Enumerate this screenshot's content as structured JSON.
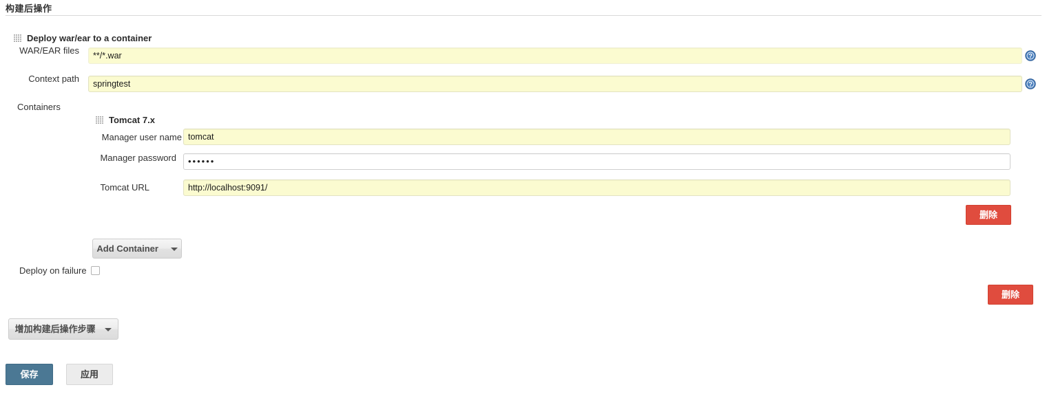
{
  "section": {
    "title": "构建后操作"
  },
  "publisher": {
    "title": "Deploy war/ear to a container",
    "grip_icon": "drag-grip-icon",
    "rows": {
      "war_label": "WAR/EAR files",
      "war_value": "**/*.war",
      "context_label": "Context path",
      "context_value": "springtest",
      "containers_label": "Containers"
    },
    "help_icon": "help-icon",
    "deploy_on_failure_label": "Deploy on failure",
    "deploy_on_failure_checked": false,
    "add_container_label": "Add Container",
    "delete_label": "删除"
  },
  "container": {
    "title": "Tomcat 7.x",
    "grip_icon": "drag-grip-icon",
    "fields": [
      {
        "label": "Manager user name",
        "value": "tomcat",
        "style": "yellow"
      },
      {
        "label": "Manager password",
        "value": "••••••",
        "style": "white"
      },
      {
        "label": "Tomcat URL",
        "value": "http://localhost:9091/",
        "style": "yellow"
      }
    ],
    "delete_label": "删除"
  },
  "footer": {
    "add_step_label": "增加构建后操作步骤",
    "save_label": "保存",
    "apply_label": "应用"
  },
  "colors": {
    "field_yellow": "#fbfbd0",
    "delete_red": "#e04c3e",
    "save_blue": "#4b7894",
    "help_blue": "#3b6ea5",
    "rule_grey": "#d9d9d9"
  }
}
